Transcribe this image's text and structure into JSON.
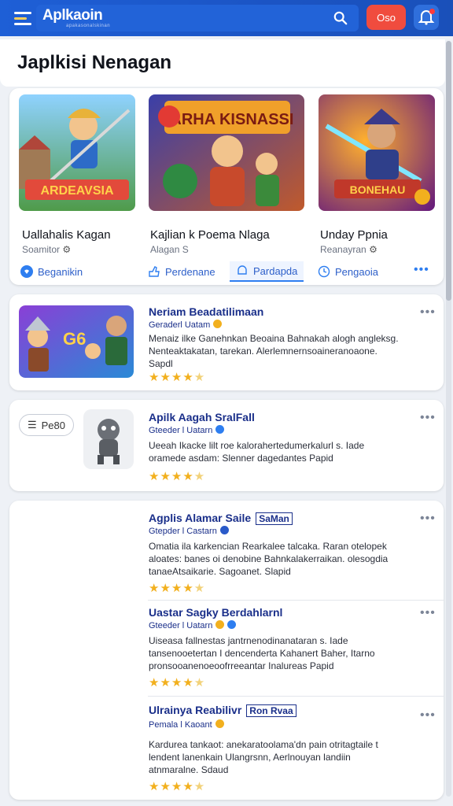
{
  "topbar": {
    "brand": "Aplkaoin",
    "brand_sub": "apakasonalskinan",
    "action_button": "Oso"
  },
  "header": {
    "title": "Japlkisi Nenagan"
  },
  "featured": {
    "items": [
      {
        "title": "Uallahalis Kagan",
        "sub": "Soamitor",
        "banner": "ARDEAVSIA"
      },
      {
        "title": "Kajlian k Poema Nlaga",
        "sub": "Alagan S",
        "banner": "PARHA KISNASSI"
      },
      {
        "title": "Unday Ppnia",
        "sub": "Reanayran",
        "banner": "BONEHAU"
      }
    ],
    "tabs": [
      {
        "label": "Beganikin"
      },
      {
        "label": "Perdenane"
      },
      {
        "label": "Pardapda"
      },
      {
        "label": "Pengaoia"
      }
    ]
  },
  "apps": [
    {
      "title": "Neriam Beadatilimaan",
      "developer": "Geraderl Uatam",
      "description": "Menaiz ilke Ganehnkan Beoaina Bahnakah alogh angleksg. Nenteaktakatan, tarekan. Alerlemnernsoaineranoaone. Sapdl",
      "rating": 4,
      "tile_text": "G6"
    },
    {
      "title": "Apilk Aagah SralFall",
      "developer": "Gteeder l Uatarn",
      "description": "Ueeah Ikacke lilt roe kalorahertedumerkalurl s. Iade oramede asdam: Slenner dagedantes Papid",
      "rating": 4,
      "pill_label": "Pe80"
    },
    {
      "title": "Agplis Alamar Saile",
      "badge": "SaMan",
      "developer": "Gtepder l Castarn",
      "description": "Omatia ila karkencian Rearkalee talcaka. Raran otelopek aloates: banes oi denobine Bahnkalakerraikan. olesogdia tanaeAtsaikarie. Sagoanet. Slapid",
      "rating": 4
    },
    {
      "title": "Uastar Sagky Berdahlarnl",
      "developer": "Gteeder l Uatarn",
      "description": "Uiseasa fallnestas jantrnenodinanataran s. Iade tansenooetertan I dencenderta Kahanert Baher, Itarno pronsooanenoeoofrreeantar Inalureas Papid",
      "rating": 4
    },
    {
      "title": "Ulrainya Reabilivr",
      "badge": "Ron Rvaa",
      "developer": "Pemala l Kaoant",
      "description": "Kardurea tankaot: anekaratoolama'dn pain otritagtaile t lendent lanenkain Ulangrsnn, Aerlnouyan landiin atnmaralne. Sdaud",
      "rating": 4
    }
  ]
}
